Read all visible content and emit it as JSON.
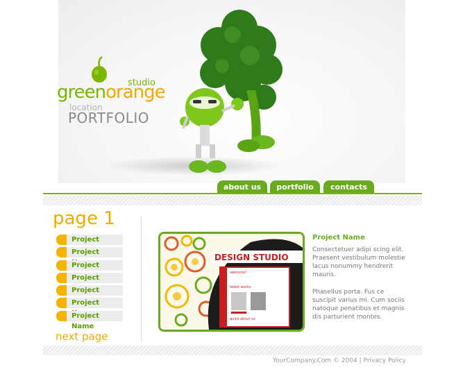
{
  "logo": {
    "studio": "studio",
    "green": "green",
    "orange": "orange",
    "location": "location",
    "portfolio": "PORTFOLIO"
  },
  "nav": {
    "tabs": [
      "about us",
      "portfolio",
      "contacts"
    ]
  },
  "sidebar": {
    "page_title": "page 1",
    "items": [
      "Project Name",
      "Project Name",
      "Project Name",
      "Project Name",
      "Project Name",
      "Project Name",
      "Project Name"
    ],
    "next": "next page"
  },
  "project": {
    "title": "Project Name",
    "paragraph1": "Consectetuer adipi scing elit. Praesent vestibulum molestie lacus nonummy hendrerit mauris.",
    "paragraph2": "Phasellus porta. Fus ce suscipit varius mi. Cum sociis natoque penatibus et magnis dis parturient montes.",
    "image_text": {
      "banner": "DESIGN STUDIO",
      "welcome": "welcome!",
      "latest": "latest works",
      "quick": "quick about us"
    }
  },
  "footer": {
    "text": "YourCompany.Com © 2004 | Privacy Policy"
  },
  "colors": {
    "green": "#6aab1e",
    "orange": "#f2a900"
  }
}
